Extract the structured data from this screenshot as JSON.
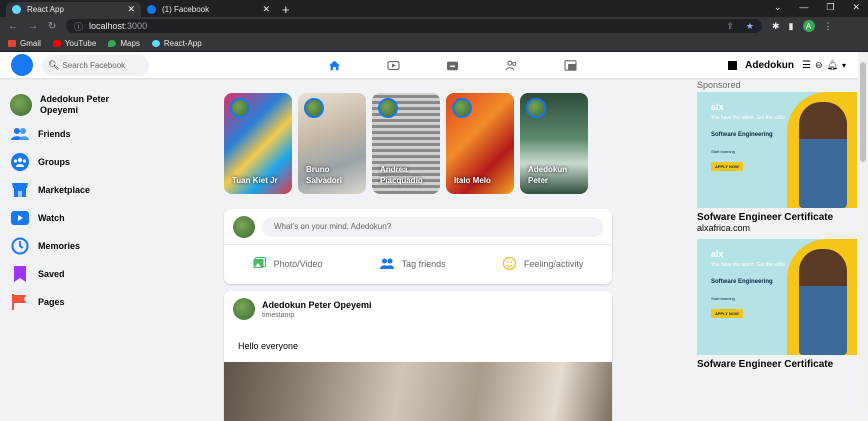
{
  "browser": {
    "tabs": [
      {
        "title": "React App",
        "active": true
      },
      {
        "title": "(1) Facebook",
        "active": false
      }
    ],
    "url_host": "localhost",
    "url_port": ":3000",
    "bookmarks": [
      "Gmail",
      "YouTube",
      "Maps",
      "React-App"
    ],
    "profile_initial": "A"
  },
  "header": {
    "search_placeholder": "Search Facebook",
    "username": "Adedokun"
  },
  "sidebar": {
    "items": [
      {
        "label": "Adedokun Peter Opeyemi",
        "icon": "user-avatar"
      },
      {
        "label": "Friends",
        "icon": "friends-icon"
      },
      {
        "label": "Groups",
        "icon": "groups-icon"
      },
      {
        "label": "Marketplace",
        "icon": "marketplace-icon"
      },
      {
        "label": "Watch",
        "icon": "watch-icon"
      },
      {
        "label": "Memories",
        "icon": "memories-icon"
      },
      {
        "label": "Saved",
        "icon": "saved-icon"
      },
      {
        "label": "Pages",
        "icon": "pages-icon"
      }
    ]
  },
  "stories": [
    {
      "name": "Tuan Kiet Jr"
    },
    {
      "name": "Bruno Salvadori"
    },
    {
      "name": "Andrea Piacquadio"
    },
    {
      "name": "Italo Melo"
    },
    {
      "name": "Adedokun Peter"
    }
  ],
  "composer": {
    "placeholder": "What's on your mind, Adedokun?",
    "actions": [
      {
        "label": "Photo/Video",
        "color": "#45bd62"
      },
      {
        "label": "Tag friends",
        "color": "#1877f2"
      },
      {
        "label": "Feeling/activity",
        "color": "#f7b928"
      }
    ]
  },
  "post": {
    "author": "Adedokun Peter Opeyemi",
    "time": "timestamp",
    "text": "Hello everyone"
  },
  "ads": {
    "sponsored_label": "Sponsored",
    "items": [
      {
        "brand": "alx",
        "tagline": "You have the talent. Get the skills",
        "course": "Software Engineering",
        "sub": "Start learning",
        "cta": "APPLY NOW",
        "title": "Sofware Engineer Certificate",
        "site": "alxafrica.com"
      },
      {
        "brand": "alx",
        "tagline": "You have the talent. Get the skills",
        "course": "Software Engineering",
        "sub": "Start learning",
        "cta": "APPLY NOW",
        "title": "Sofware Engineer Certificate",
        "site": ""
      }
    ]
  }
}
